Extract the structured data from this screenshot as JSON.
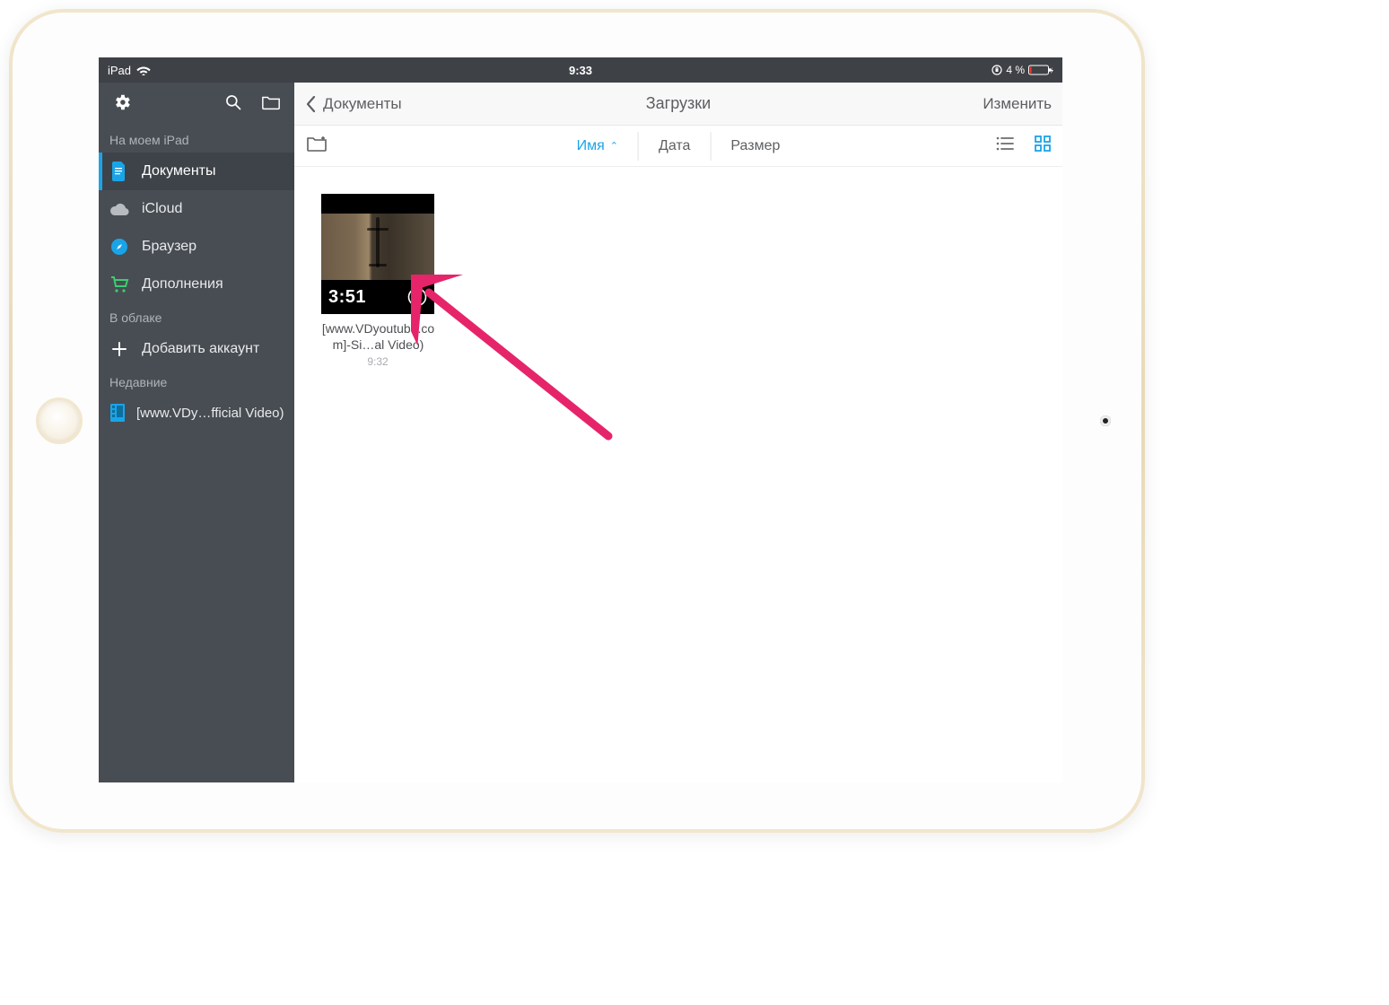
{
  "status": {
    "device": "iPad",
    "time": "9:33",
    "orientation_lock": true,
    "battery_pct": "4 %"
  },
  "sidebar": {
    "section_on_device": "На моем iPad",
    "section_cloud": "В облаке",
    "section_recent": "Недавние",
    "items": {
      "documents": "Документы",
      "icloud": "iCloud",
      "browser": "Браузер",
      "addons": "Дополнения",
      "add_account": "Добавить аккаунт"
    },
    "recent_file": "[www.VDy…fficial Video)"
  },
  "header": {
    "back_label": "Документы",
    "title": "Загрузки",
    "edit": "Изменить"
  },
  "sortbar": {
    "name": "Имя",
    "date": "Дата",
    "size": "Размер",
    "caret": "⌃"
  },
  "file": {
    "duration": "3:51",
    "name": "[www.VDyoutube.com]-Si…al Video)",
    "time": "9:32"
  },
  "colors": {
    "accent": "#1aa4e8",
    "sidebar_bg": "#484d53",
    "status_bg": "#3e4146",
    "arrow": "#e6246a"
  }
}
